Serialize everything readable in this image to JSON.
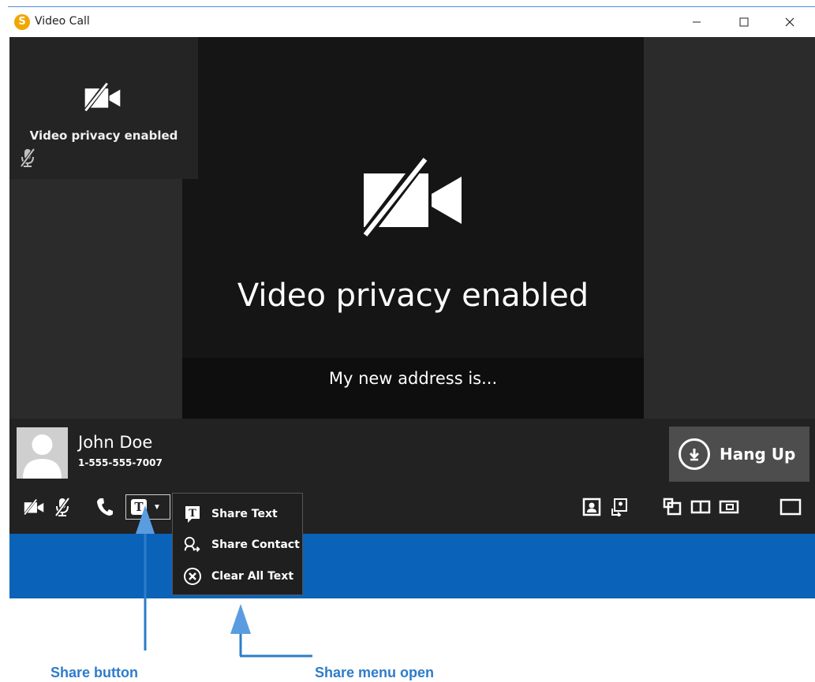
{
  "window": {
    "title": "Video Call",
    "logo_letter": "S"
  },
  "self_view": {
    "status_text": "Video privacy enabled",
    "camera_icon": "video-off-icon",
    "mic_icon": "mic-off-icon"
  },
  "main_video": {
    "status_text": "Video privacy enabled",
    "camera_icon": "video-off-icon",
    "caption_text": "My new address is..."
  },
  "contact": {
    "name": "John Doe",
    "number": "1-555-555-7007",
    "avatar_icon": "person-avatar-icon"
  },
  "hangup": {
    "label": "Hang Up",
    "icon": "hang-up-icon"
  },
  "toolbar": {
    "left": [
      "video-privacy-icon",
      "mute-icon",
      "phone-icon"
    ],
    "share_letter": "T",
    "right": [
      "self-view-icon",
      "share-screen-icon",
      "layout-pip-icon",
      "layout-side-by-side-icon",
      "layout-small-icon",
      "layout-full-icon"
    ]
  },
  "share_menu": {
    "items": [
      {
        "label": "Share Text",
        "icon": "share-text-icon",
        "icon_letter": "T"
      },
      {
        "label": "Share Contact",
        "icon": "share-contact-icon"
      },
      {
        "label": "Clear All Text",
        "icon": "clear-all-text-icon"
      }
    ]
  },
  "annotations": {
    "share_button_label": "Share button",
    "share_menu_label": "Share menu open",
    "color": "#2e7cc9"
  },
  "colors": {
    "accent_blue": "#0a63b8",
    "panel_dark": "#222222",
    "hangup_bg": "#4d4d4d"
  }
}
